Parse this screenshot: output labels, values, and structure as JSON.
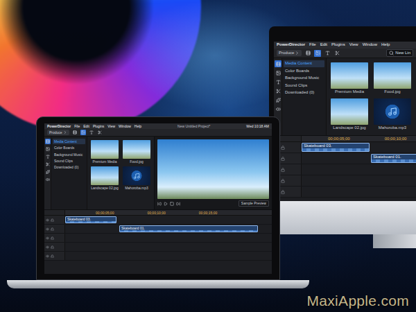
{
  "watermark": "MaxiApple.com",
  "laptop": {
    "menu": [
      "PowerDirector",
      "File",
      "Edit",
      "Plugins",
      "View",
      "Window",
      "Help"
    ],
    "title": "New Untitled Project*",
    "clock": "Wed 10:18 AM",
    "mode": "Produce",
    "sidebar": [
      {
        "label": "Media Content",
        "selected": true
      },
      {
        "label": "Color Boards",
        "selected": false
      },
      {
        "label": "Background Music",
        "selected": false
      },
      {
        "label": "Sound Clips",
        "selected": false
      },
      {
        "label": "Downloaded (0)",
        "selected": false
      }
    ],
    "media": [
      {
        "label": "Premium Media",
        "kind": "photo"
      },
      {
        "label": "Food.jpg",
        "kind": "photo"
      },
      {
        "label": "Landscape 02.jpg",
        "kind": "photo"
      },
      {
        "label": "Mahoroba.mp3",
        "kind": "audio"
      }
    ],
    "preview": {
      "caption": "Sample Preview"
    },
    "ruler": [
      "00;00;05;00",
      "00;00;10;00",
      "00;00;15;00"
    ],
    "tracks": [
      {
        "clips": [
          {
            "label": "Skateboard 03."
          }
        ]
      },
      {
        "clips": [
          {
            "label": "Skateboard 01."
          }
        ]
      }
    ]
  },
  "imac": {
    "menu": [
      "PowerDirector",
      "File",
      "Edit",
      "Plugins",
      "View",
      "Window",
      "Help"
    ],
    "mode": "Produce",
    "search": "New Lin",
    "sidebar": [
      {
        "label": "Media Content",
        "selected": true
      },
      {
        "label": "Color Boards",
        "selected": false
      },
      {
        "label": "Background Music",
        "selected": false
      },
      {
        "label": "Sound Clips",
        "selected": false
      },
      {
        "label": "Downloaded (0)",
        "selected": false
      }
    ],
    "media": [
      {
        "label": "Premium Media",
        "kind": "photo"
      },
      {
        "label": "Food.jpg",
        "kind": "photo"
      },
      {
        "label": "Landscape 02.jpg",
        "kind": "photo"
      },
      {
        "label": "Mahoroba.mp3",
        "kind": "audio"
      }
    ],
    "ruler": [
      "00;00;05;00",
      "00;00;10;00"
    ],
    "tracks": [
      {
        "clips": [
          {
            "label": "Skateboard 03."
          }
        ]
      },
      {
        "clips": [
          {
            "label": "Skateboard 01."
          }
        ]
      }
    ]
  }
}
